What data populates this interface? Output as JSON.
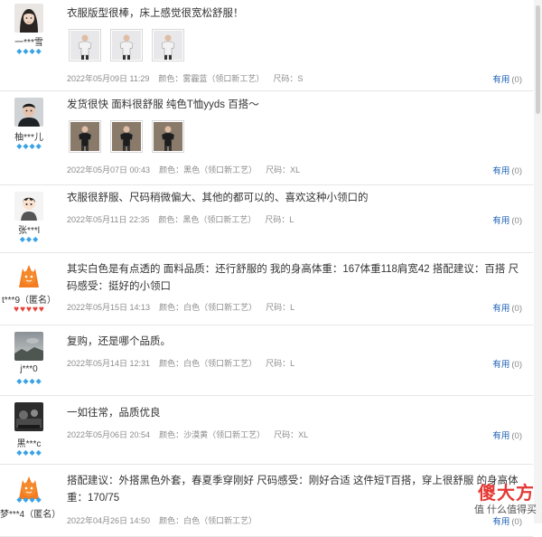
{
  "reviews": [
    {
      "avatar": "girl-avatar",
      "user": "一***雪",
      "badge_type": "diamond",
      "badge_count": 4,
      "text": "衣服版型很棒，床上感觉很宽松舒服！",
      "photos": [
        "photo-1",
        "photo-2",
        "photo-3"
      ],
      "date": "2022年05月09日 11:29",
      "color": "颜色：雾霾蓝（领口新工艺）",
      "size": "尺码：S",
      "helpful_label": "有用",
      "helpful_count": "(0)"
    },
    {
      "avatar": "boy-avatar",
      "user": "柚***儿",
      "badge_type": "diamond",
      "badge_count": 4,
      "text": "发货很快 面料很舒服 纯色T恤yyds 百搭～",
      "photos": [
        "photo-1",
        "photo-2",
        "photo-3"
      ],
      "date": "2022年05月07日 00:43",
      "color": "颜色：黑色（领口新工艺）",
      "size": "尺码：XL",
      "helpful_label": "有用",
      "helpful_count": "(0)"
    },
    {
      "avatar": "cartoon-avatar",
      "user": "张***l",
      "badge_type": "diamond",
      "badge_count": 3,
      "text": "衣服很舒服、尺码稍微偏大、其他的都可以的、喜欢这种小领口的",
      "photos": [],
      "date": "2022年05月11日 22:35",
      "color": "颜色：黑色（领口新工艺）",
      "size": "尺码：L",
      "helpful_label": "有用",
      "helpful_count": "(0)"
    },
    {
      "avatar": "default-avatar",
      "user": "t***9（匿名）",
      "badge_type": "heart",
      "badge_count": 5,
      "text": "其实白色是有点透的 面料品质：还行舒服的 我的身高体重：167体重118肩宽42 搭配建议：百搭 尺码感受：挺好的小领口",
      "photos": [],
      "date": "2022年05月15日 14:13",
      "color": "颜色：白色（领口新工艺）",
      "size": "尺码：L",
      "helpful_label": "有用",
      "helpful_count": "(0)"
    },
    {
      "avatar": "landscape-avatar",
      "user": "j***0",
      "badge_type": "diamond",
      "badge_count": 4,
      "text": "复购，还是哪个品质。",
      "photos": [],
      "date": "2022年05月14日 12:31",
      "color": "颜色：白色（领口新工艺）",
      "size": "尺码：L",
      "helpful_label": "有用",
      "helpful_count": "(0)"
    },
    {
      "avatar": "dark-avatar",
      "user": "黑***c",
      "badge_type": "diamond",
      "badge_count": 4,
      "text": "一如往常，品质优良",
      "photos": [],
      "date": "2022年05月06日 20:54",
      "color": "颜色：沙漠黄（领口新工艺）",
      "size": "尺码：XL",
      "helpful_label": "有用",
      "helpful_count": "(0)"
    },
    {
      "avatar": "default-avatar",
      "user": "梦***4（匿名）",
      "badge_type": "diamond",
      "badge_count": 4,
      "text": "搭配建议：外搭黑色外套，春夏季穿刚好 尺码感受：刚好合适 这件短T百搭，穿上很舒服 的身高体重：170/75",
      "photos": [],
      "date": "2022年04月26日 14:50",
      "color": "颜色：白色（领口新工艺）",
      "size": "",
      "helpful_label": "有用",
      "helpful_count": "(0)"
    }
  ],
  "watermark": {
    "main": "傻大方",
    "sub": "值 什么值得买"
  }
}
